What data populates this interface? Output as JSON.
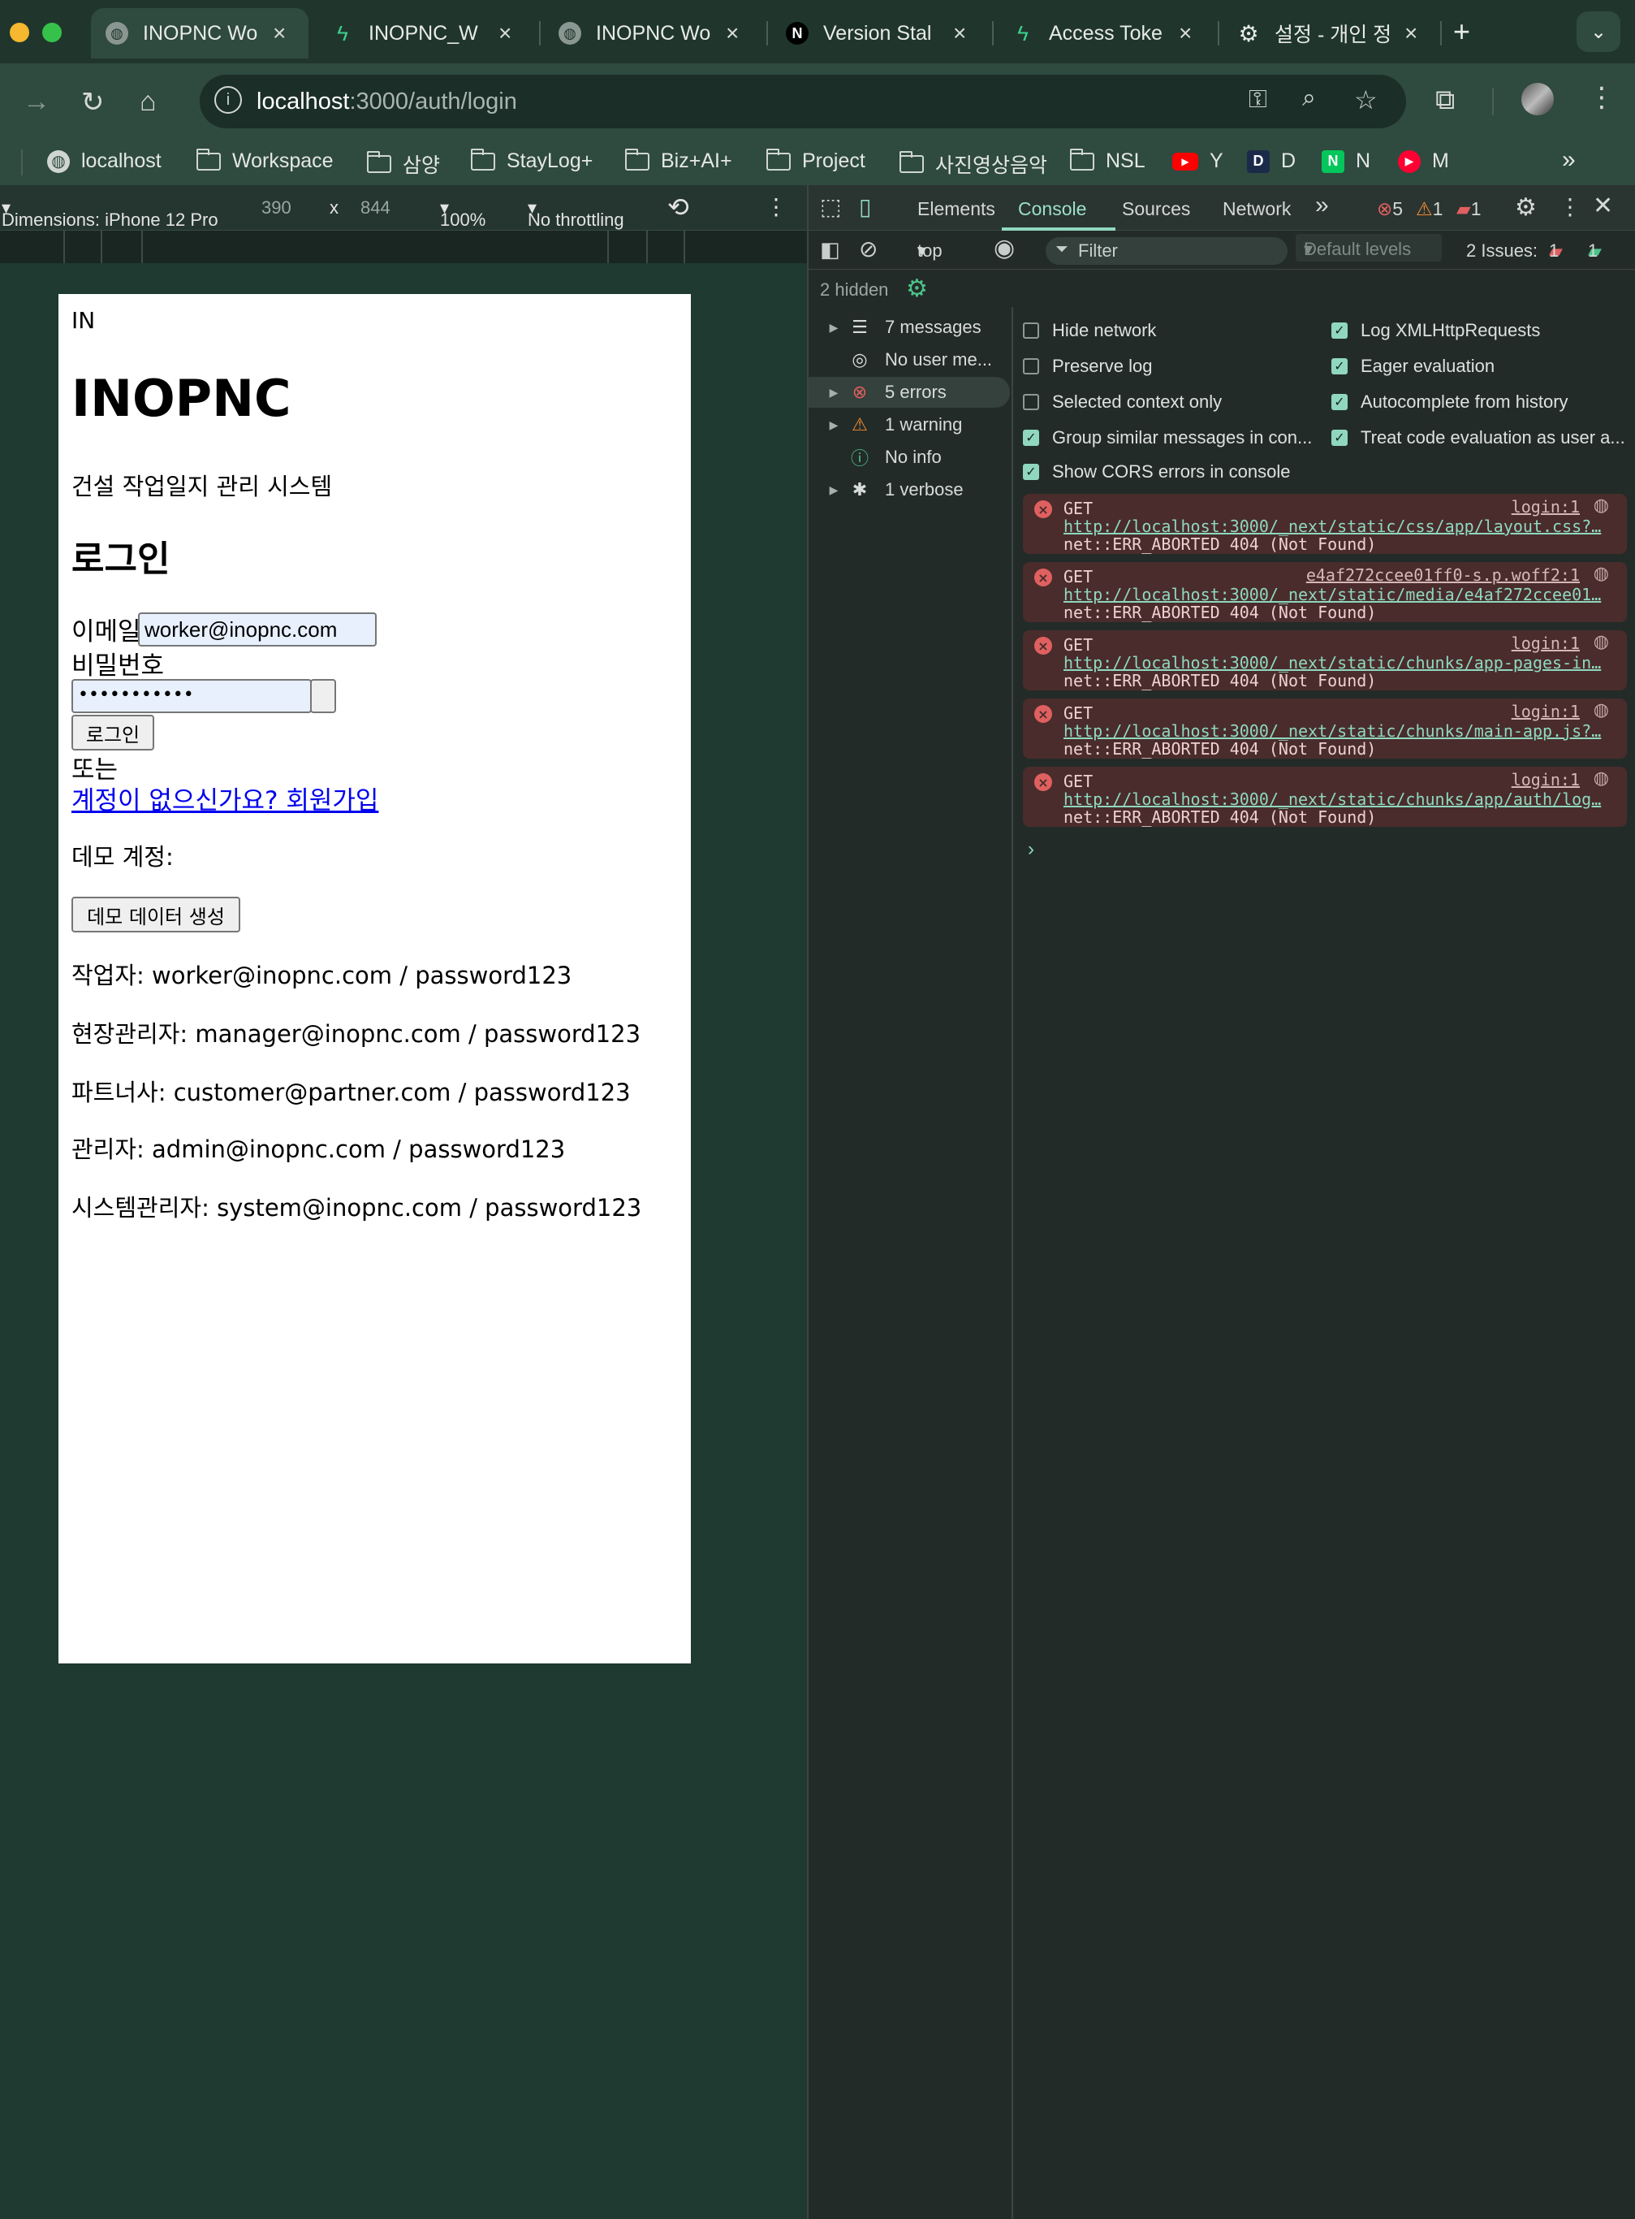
{
  "colors": {
    "accent": "#8fd8bf",
    "error": "#e06060",
    "warning": "#f08a30",
    "link": "#0000ee",
    "chrome_bg": "#20362d"
  },
  "tabs": [
    {
      "title": "INOPNC Wo",
      "icon": "globe-icon"
    },
    {
      "title": "INOPNC_W",
      "icon": "supabase-icon"
    },
    {
      "title": "INOPNC Wo",
      "icon": "globe-icon"
    },
    {
      "title": "Version Stal",
      "icon": "nextjs-icon"
    },
    {
      "title": "Access Toke",
      "icon": "supabase-icon"
    },
    {
      "title": "설정 - 개인 정",
      "icon": "gear-icon"
    }
  ],
  "address_bar": {
    "host": "localhost",
    "path": ":3000/auth/login"
  },
  "bookmarks": [
    {
      "label": "localhost",
      "icon": "globe-icon"
    },
    {
      "label": "Workspace",
      "icon": "folder-icon"
    },
    {
      "label": "삼양",
      "icon": "folder-icon"
    },
    {
      "label": "StayLog+",
      "icon": "folder-icon"
    },
    {
      "label": "Biz+AI+",
      "icon": "folder-icon"
    },
    {
      "label": "Project",
      "icon": "folder-icon"
    },
    {
      "label": "사진영상음악",
      "icon": "folder-icon"
    },
    {
      "label": "NSL",
      "icon": "folder-icon"
    },
    {
      "label": "Y",
      "icon": "youtube-icon"
    },
    {
      "label": "D",
      "icon": "d-icon"
    },
    {
      "label": "N",
      "icon": "naver-icon"
    },
    {
      "label": "M",
      "icon": "music-icon"
    }
  ],
  "device_toolbar": {
    "dimensions": "Dimensions: iPhone 12 Pro",
    "width": "390",
    "times": "x",
    "height": "844",
    "zoom": "100%",
    "throttling": "No throttling"
  },
  "page": {
    "logo_alt": "IN",
    "brand": "INOPNC",
    "subtitle": "건설 작업일지 관리 시스템",
    "heading": "로그인",
    "email_label": "이메일",
    "email_value": "worker@inopnc.com",
    "password_label": "비밀번호",
    "password_value": "•••••••••••",
    "login_button": "로그인",
    "or_text": "또는",
    "signup_link": "계정이 없으신가요? 회원가입",
    "demo_heading": "데모 계정:",
    "demo_button": "데모 데이터 생성",
    "accounts": [
      "작업자: worker@inopnc.com / password123",
      "현장관리자: manager@inopnc.com / password123",
      "파트너사: customer@partner.com / password123",
      "관리자: admin@inopnc.com / password123",
      "시스템관리자: system@inopnc.com / password123"
    ]
  },
  "devtools": {
    "tabs": [
      "Elements",
      "Console",
      "Sources",
      "Network"
    ],
    "active_tab": "Console",
    "counts": {
      "errors": "5",
      "warnings": "1",
      "issues": "1"
    },
    "context": "top",
    "filter_placeholder": "Filter",
    "levels": "Default levels",
    "issues_label": "2 Issues:",
    "issues_error": "1",
    "issues_info": "1",
    "hidden": "2 hidden",
    "sidebar": [
      {
        "label": "7 messages",
        "icon": "list-icon",
        "expandable": true
      },
      {
        "label": "No user me...",
        "icon": "user-icon",
        "expandable": false
      },
      {
        "label": "5 errors",
        "icon": "error-icon",
        "expandable": true
      },
      {
        "label": "1 warning",
        "icon": "warning-icon",
        "expandable": true
      },
      {
        "label": "No info",
        "icon": "info-icon",
        "expandable": false
      },
      {
        "label": "1 verbose",
        "icon": "bug-icon",
        "expandable": true
      }
    ],
    "settings_left": [
      {
        "label": "Hide network",
        "checked": false
      },
      {
        "label": "Preserve log",
        "checked": false
      },
      {
        "label": "Selected context only",
        "checked": false
      },
      {
        "label": "Group similar messages in con...",
        "checked": true
      },
      {
        "label": "Show CORS errors in console",
        "checked": true
      }
    ],
    "settings_right": [
      {
        "label": "Log XMLHttpRequests",
        "checked": true
      },
      {
        "label": "Eager evaluation",
        "checked": true
      },
      {
        "label": "Autocomplete from history",
        "checked": true
      },
      {
        "label": "Treat code evaluation as user a...",
        "checked": true
      }
    ],
    "errors": [
      {
        "method": "GET",
        "source": "login:1",
        "url": "http://localhost:3000/_next/static/css/app/layout.css?…",
        "message": "net::ERR_ABORTED 404 (Not Found)"
      },
      {
        "method": "GET",
        "source": "e4af272ccee01ff0-s.p.woff2:1",
        "url": "http://localhost:3000/_next/static/media/e4af272ccee01…",
        "message": "net::ERR_ABORTED 404 (Not Found)"
      },
      {
        "method": "GET",
        "source": "login:1",
        "url": "http://localhost:3000/_next/static/chunks/app-pages-in…",
        "message": "net::ERR_ABORTED 404 (Not Found)"
      },
      {
        "method": "GET",
        "source": "login:1",
        "url": "http://localhost:3000/_next/static/chunks/main-app.js?…",
        "message": "net::ERR_ABORTED 404 (Not Found)"
      },
      {
        "method": "GET",
        "source": "login:1",
        "url": "http://localhost:3000/_next/static/chunks/app/auth/log…",
        "message": "net::ERR_ABORTED 404 (Not Found)"
      }
    ]
  }
}
